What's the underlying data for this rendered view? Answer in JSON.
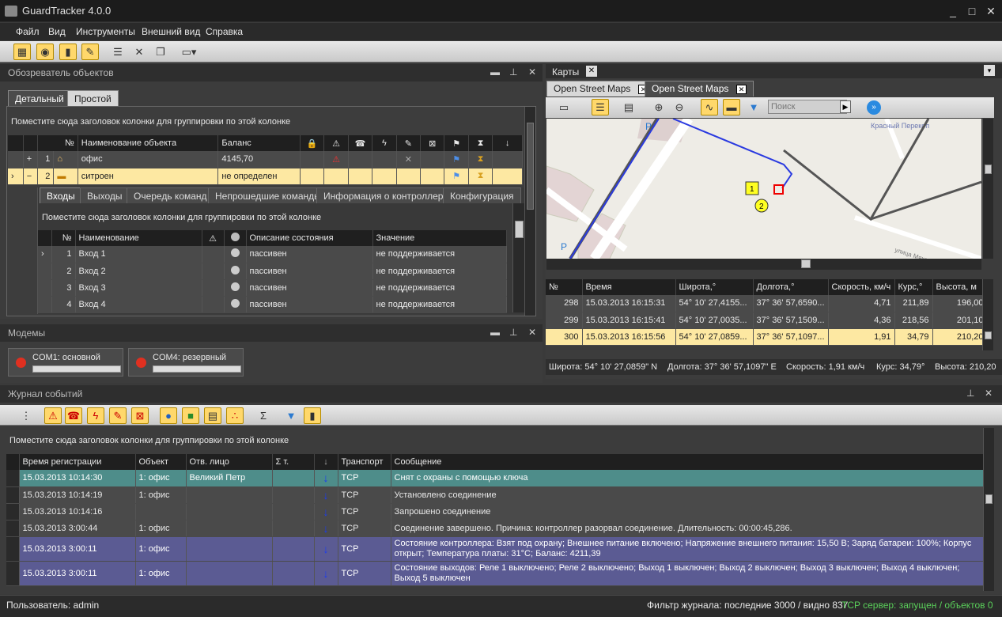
{
  "app": {
    "title": "GuardTracker 4.0.0"
  },
  "menu": [
    "Файл",
    "Вид",
    "Инструменты",
    "Внешний вид",
    "Справка"
  ],
  "toolbar_icons": [
    "calendar-icon",
    "globe-icon",
    "device-icon",
    "notes-icon",
    "database-icon",
    "tools-icon",
    "windows-icon",
    "folder-icon"
  ],
  "explorer": {
    "title": "Обозреватель объектов",
    "tabs": [
      "Детальный",
      "Простой"
    ],
    "group_hint": "Поместите сюда заголовок колонки для группировки по этой колонке",
    "columns": [
      "№",
      "Наименование объекта",
      "Баланс"
    ],
    "rows": [
      {
        "expand": "+",
        "num": "1",
        "name": "офис",
        "balance": "4145,70",
        "icon": "house-icon"
      },
      {
        "expand": "−",
        "num": "2",
        "name": "ситроен",
        "balance": "не определен",
        "icon": "truck-icon"
      }
    ],
    "subtabs": [
      "Входы",
      "Выходы",
      "Очередь команд",
      "Непрошедшие команды",
      "Информация о контроллере",
      "Конфигурация"
    ],
    "sub_group_hint": "Поместите сюда заголовок колонки для группировки по этой колонке",
    "sub_columns": [
      "№",
      "Наименование",
      "Описание состояния",
      "Значение"
    ],
    "sub_rows": [
      {
        "num": "1",
        "name": "Вход 1",
        "state": "пассивен",
        "value": "не поддерживается"
      },
      {
        "num": "2",
        "name": "Вход 2",
        "state": "пассивен",
        "value": "не поддерживается"
      },
      {
        "num": "3",
        "name": "Вход 3",
        "state": "пассивен",
        "value": "не поддерживается"
      },
      {
        "num": "4",
        "name": "Вход 4",
        "state": "пассивен",
        "value": "не поддерживается"
      }
    ]
  },
  "modems": {
    "title": "Модемы",
    "items": [
      "COM1: основной",
      "COM4: резервный"
    ]
  },
  "maps": {
    "title": "Карты",
    "tabs": [
      "Open Street Maps",
      "Open Street Maps"
    ],
    "search_placeholder": "Поиск",
    "street1": "Красный Перекоп",
    "street2": "улица Мякова",
    "markers": [
      "1",
      "2"
    ],
    "columns": [
      "№",
      "Время",
      "Широта,°",
      "Долгота,°",
      "Скорость, км/ч",
      "Курс,°",
      "Высота, м"
    ],
    "rows": [
      {
        "num": "298",
        "time": "15.03.2013 16:15:31",
        "lat": "54° 10' 27,4155...",
        "lon": "37° 36' 57,6590...",
        "speed": "4,71",
        "course": "211,89",
        "alt": "196,00"
      },
      {
        "num": "299",
        "time": "15.03.2013 16:15:41",
        "lat": "54° 10' 27,0035...",
        "lon": "37° 36' 57,1509...",
        "speed": "4,36",
        "course": "218,56",
        "alt": "201,10"
      },
      {
        "num": "300",
        "time": "15.03.2013 16:15:56",
        "lat": "54° 10' 27,0859...",
        "lon": "37° 36' 57,1097...",
        "speed": "1,91",
        "course": "34,79",
        "alt": "210,20"
      }
    ],
    "status": [
      "Широта: 54° 10' 27,0859\" N",
      "Долгота: 37° 36' 57,1097\" E",
      "Скорость: 1,91 км/ч",
      "Курс: 34,79°",
      "Высота: 210,20"
    ]
  },
  "journal": {
    "title": "Журнал событий",
    "group_hint": "Поместите сюда заголовок колонки для группировки по этой колонке",
    "columns": [
      "Время регистрации",
      "Объект",
      "Отв. лицо",
      "Σ т.",
      "",
      "Транспорт",
      "Сообщение"
    ],
    "rows": [
      {
        "time": "15.03.2013 10:14:30",
        "obj": "1: офис",
        "person": "Великий Петр",
        "transport": "TCP",
        "msg": "Снят с охраны с помощью ключа",
        "style": "r-teal"
      },
      {
        "time": "15.03.2013 10:14:19",
        "obj": "1: офис",
        "person": "",
        "transport": "TCP",
        "msg": "Установлено соединение",
        "style": "r-dark"
      },
      {
        "time": "15.03.2013 10:14:16",
        "obj": "",
        "person": "",
        "transport": "TCP",
        "msg": "Запрошено соединение",
        "style": "r-dark"
      },
      {
        "time": "15.03.2013 3:00:44",
        "obj": "1: офис",
        "person": "",
        "transport": "TCP",
        "msg": "Соединение завершено. Причина: контроллер разорвал соединение. Длительность: 00:00:45,286.",
        "style": "r-dark"
      },
      {
        "time": "15.03.2013 3:00:11",
        "obj": "1: офис",
        "person": "",
        "transport": "TCP",
        "msg": "Состояние контроллера: Взят под охрану; Внешнее питание включено; Напряжение внешнего питания: 15,50 В; Заряд батареи: 100%; Корпус открыт; Температура платы: 31°C; Баланс: 4211,39",
        "style": "r-purple"
      },
      {
        "time": "15.03.2013 3:00:11",
        "obj": "1: офис",
        "person": "",
        "transport": "TCP",
        "msg": "Состояние выходов: Реле 1 выключено; Реле 2 выключено; Выход 1 выключен; Выход 2 выключен; Выход 3 выключен; Выход 4 выключен; Выход 5 выключен",
        "style": "r-purple"
      }
    ]
  },
  "status": {
    "user": "Пользователь: admin",
    "filter": "Фильтр журнала: последние 3000 / видно 837",
    "server": "TCP сервер: запущен / объектов 0"
  }
}
